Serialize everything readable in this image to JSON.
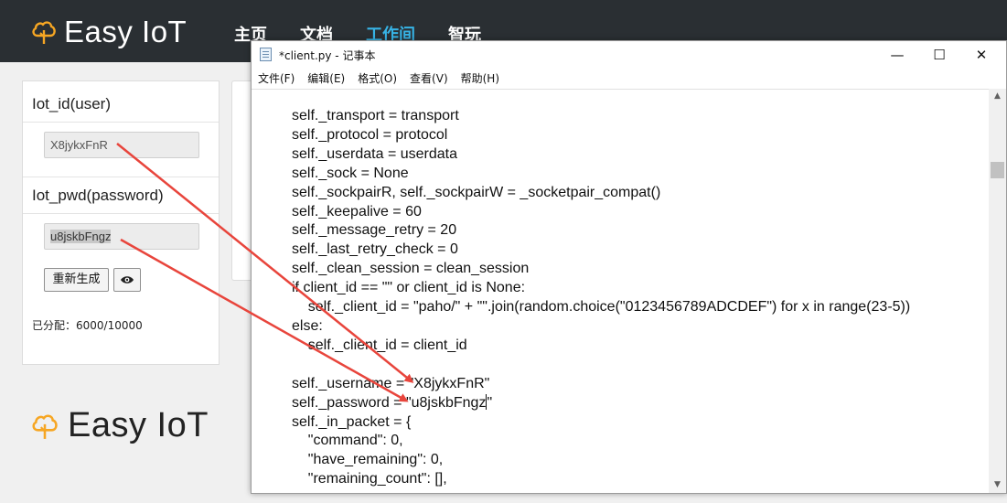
{
  "header": {
    "brand": "Easy IoT",
    "nav": [
      {
        "label": "主页"
      },
      {
        "label": "文档"
      },
      {
        "label": "工作间"
      },
      {
        "label": "智玩"
      }
    ],
    "active_nav": "工作间",
    "accent_color": "#37b4e6",
    "bar_color": "#2a2f33"
  },
  "panel": {
    "iot_id_title": "Iot_id(user)",
    "iot_id_value": "X8jykxFnR",
    "iot_pwd_title": "Iot_pwd(password)",
    "iot_pwd_value": "u8jskbFngz",
    "regenerate_label": "重新生成",
    "eye_icon": "eye-icon",
    "allocated": "已分配：6000/10000"
  },
  "footer_brand": "Easy IoT",
  "notepad": {
    "title": "*client.py - 记事本",
    "window_buttons": [
      "—",
      "☐",
      "✕"
    ],
    "menu": [
      "文件(F)",
      "编辑(E)",
      "格式(O)",
      "查看(V)",
      "帮助(H)"
    ],
    "code_before_cursor": "self._transport = transport\nself._protocol = protocol\nself._userdata = userdata\nself._sock = None\nself._sockpairR, self._sockpairW = _socketpair_compat()\nself._keepalive = 60\nself._message_retry = 20\nself._last_retry_check = 0\nself._clean_session = clean_session\nif client_id == \"\" or client_id is None:\n    self._client_id = \"paho/\" + \"\".join(random.choice(\"0123456789ADCDEF\") for x in range(23-5))\nelse:\n    self._client_id = client_id\n\nself._username = \"X8jykxFnR\"\nself._password = \"u8jskbFngz",
    "code_after_cursor": "\"\nself._in_packet = {\n    \"command\": 0,\n    \"have_remaining\": 0,\n    \"remaining_count\": [],"
  },
  "annotation_color": "#e8453c"
}
